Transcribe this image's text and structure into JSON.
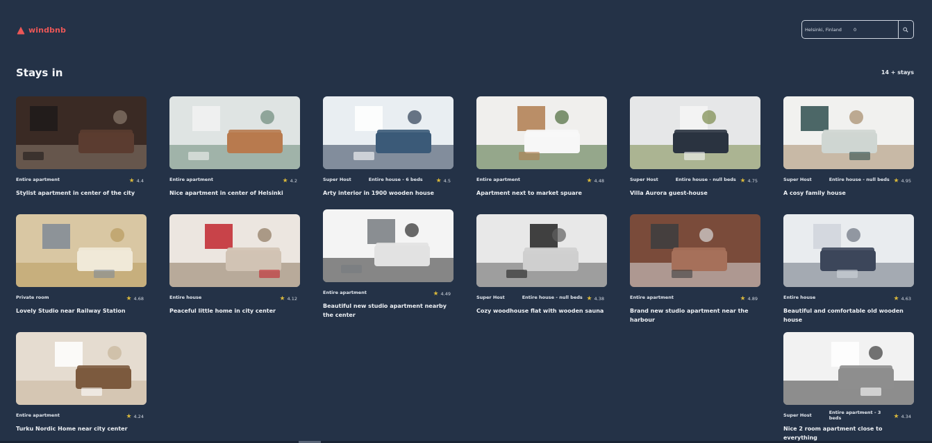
{
  "brand": {
    "name": "windbnb",
    "accent": "#eb5757"
  },
  "search": {
    "location": "Helsinki, Finland",
    "guests": "0",
    "icon": "search-icon"
  },
  "header": {
    "title": "Stays in",
    "count": "14 + stays"
  },
  "stays": [
    {
      "superhost": "",
      "type": "Entire apartment",
      "rating": "4.4",
      "title": "Stylist apartment in center of the city"
    },
    {
      "superhost": "",
      "type": "Entire apartment",
      "rating": "4.2",
      "title": "Nice apartment in center of Helsinki"
    },
    {
      "superhost": "Super Host",
      "type": "Entire house - 6 beds",
      "rating": "4.5",
      "title": "Arty interior in 1900 wooden house"
    },
    {
      "superhost": "",
      "type": "Entire apartment",
      "rating": "4.48",
      "title": "Apartment next to market spuare"
    },
    {
      "superhost": "Super Host",
      "type": "Entire house - null beds",
      "rating": "4.75",
      "title": "Villa Aurora guest-house"
    },
    {
      "superhost": "Super Host",
      "type": "Entire house - null beds",
      "rating": "4.95",
      "title": "A cosy family house"
    },
    {
      "superhost": "",
      "type": "Private room",
      "rating": "4.68",
      "title": "Lovely Studio near Railway Station"
    },
    {
      "superhost": "",
      "type": "Entire house",
      "rating": "4.12",
      "title": "Peaceful little home in city center"
    },
    {
      "superhost": "",
      "type": "Entire apartment",
      "rating": "4.49",
      "title": "Beautiful new studio apartment nearby the center"
    },
    {
      "superhost": "Super Host",
      "type": "Entire house - null beds",
      "rating": "4.38",
      "title": "Cozy woodhouse flat with wooden sauna"
    },
    {
      "superhost": "",
      "type": "Entire apartment",
      "rating": "4.89",
      "title": "Brand new studio apartment near the harbour"
    },
    {
      "superhost": "",
      "type": "Entire house",
      "rating": "4.63",
      "title": "Beautiful and comfortable old wooden house"
    },
    {
      "superhost": "",
      "type": "Entire apartment",
      "rating": "4.24",
      "title": "Turku Nordic Home near city center"
    },
    {
      "superhost": "Super Host",
      "type": "Entire apartment - 3 beds",
      "rating": "4.34",
      "title": "Nice 2 room apartment close to everything"
    }
  ]
}
